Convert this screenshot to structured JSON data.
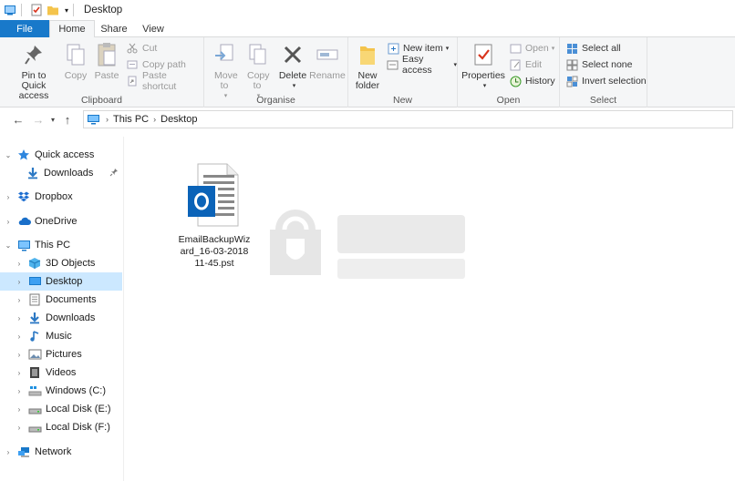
{
  "window": {
    "title": "Desktop"
  },
  "tabs": [
    {
      "label": "File"
    },
    {
      "label": "Home"
    },
    {
      "label": "Share"
    },
    {
      "label": "View"
    }
  ],
  "ribbon": {
    "clipboard": {
      "label": "Clipboard",
      "pin_quick_access": "Pin to Quick access",
      "copy": "Copy",
      "paste": "Paste",
      "cut": "Cut",
      "copy_path": "Copy path",
      "paste_shortcut": "Paste shortcut"
    },
    "organise": {
      "label": "Organise",
      "move_to": "Move to",
      "copy_to": "Copy to",
      "delete": "Delete",
      "rename": "Rename"
    },
    "new": {
      "label": "New",
      "new_folder": "New folder",
      "new_item": "New item",
      "easy_access": "Easy access"
    },
    "open": {
      "label": "Open",
      "properties": "Properties",
      "open": "Open",
      "edit": "Edit",
      "history": "History"
    },
    "select": {
      "label": "Select",
      "select_all": "Select all",
      "select_none": "Select none",
      "invert_selection": "Invert selection"
    }
  },
  "address": {
    "crumbs": [
      "This PC",
      "Desktop"
    ]
  },
  "navpane": {
    "items": [
      {
        "label": "Quick access",
        "icon": "star-icon"
      },
      {
        "label": "Downloads",
        "icon": "download-icon"
      },
      {
        "label": "Dropbox",
        "icon": "dropbox-icon"
      },
      {
        "label": "OneDrive",
        "icon": "cloud-icon"
      },
      {
        "label": "This PC",
        "icon": "monitor-icon"
      },
      {
        "label": "3D Objects",
        "icon": "cube-icon"
      },
      {
        "label": "Desktop",
        "icon": "desktop-icon"
      },
      {
        "label": "Documents",
        "icon": "document-icon"
      },
      {
        "label": "Downloads",
        "icon": "download-icon"
      },
      {
        "label": "Music",
        "icon": "music-icon"
      },
      {
        "label": "Pictures",
        "icon": "picture-icon"
      },
      {
        "label": "Videos",
        "icon": "video-icon"
      },
      {
        "label": "Windows (C:)",
        "icon": "drive-icon"
      },
      {
        "label": "Local Disk (E:)",
        "icon": "drive-icon"
      },
      {
        "label": "Local Disk (F:)",
        "icon": "drive-icon"
      },
      {
        "label": "Network",
        "icon": "network-icon"
      }
    ]
  },
  "content": {
    "files": [
      {
        "name": "EmailBackupWizard_16-03-2018 11-45.pst",
        "icon": "outlook-pst-icon"
      }
    ]
  },
  "colors": {
    "accent": "#1979ca",
    "selection": "#cce8ff",
    "ribbon_bg": "#f5f6f7"
  }
}
